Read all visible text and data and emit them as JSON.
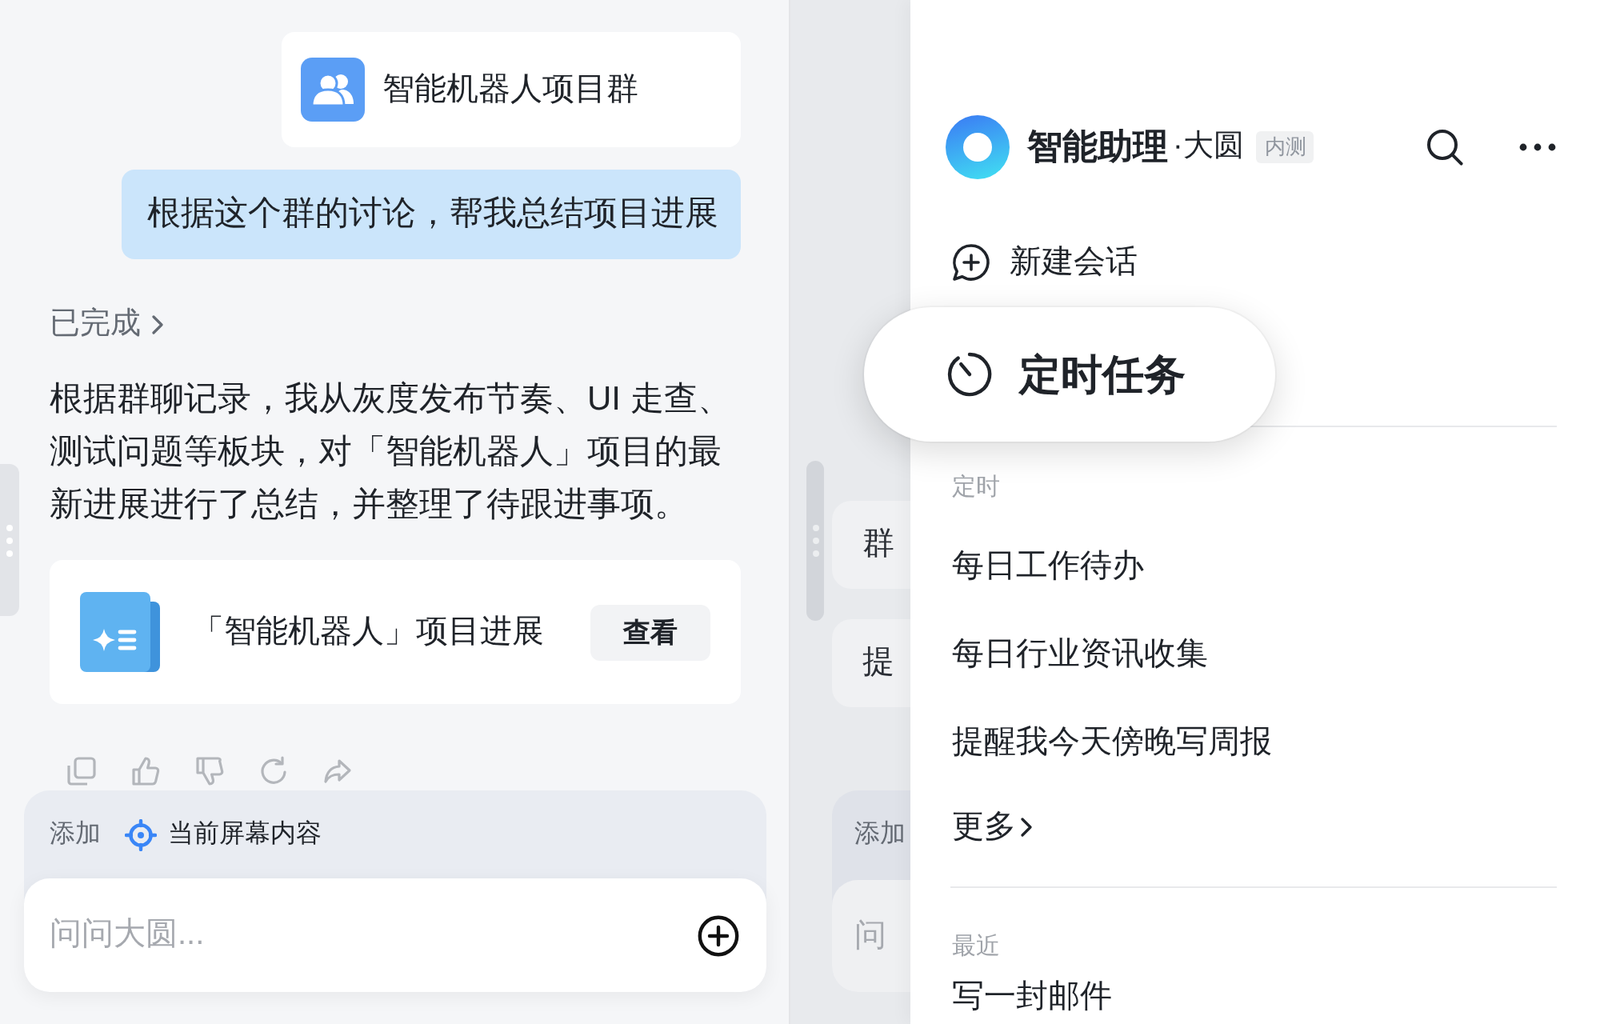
{
  "chat": {
    "shared_group": {
      "name": "智能机器人项目群"
    },
    "user_message": "根据这个群的讨论，帮我总结项目进展",
    "status": "已完成",
    "reply": "根据群聊记录，我从灰度发布节奏、UI 走查、测试问题等板块，对「智能机器人」项目的最新进展进行了总结，并整理了待跟进事项。",
    "document": {
      "title": "「智能机器人」项目进展",
      "action": "查看"
    },
    "composer": {
      "add_label": "添加",
      "context_chip": "当前屏幕内容",
      "placeholder": "问问大圆..."
    }
  },
  "background_chat": {
    "cards": [
      "群",
      "提"
    ],
    "composer": {
      "add_label": "添加",
      "placeholder": "问"
    }
  },
  "assistant_panel": {
    "title": "智能助理",
    "subtitle": "·大圆",
    "badge": "内测",
    "new_chat": "新建会话",
    "sections": [
      {
        "heading": "定时",
        "items": [
          "每日工作待办",
          "每日行业资讯收集",
          "提醒我今天傍晚写周报"
        ],
        "more": "更多"
      },
      {
        "heading": "最近",
        "items": [
          "写一封邮件"
        ]
      }
    ]
  },
  "floating_item": {
    "label": "定时任务"
  }
}
